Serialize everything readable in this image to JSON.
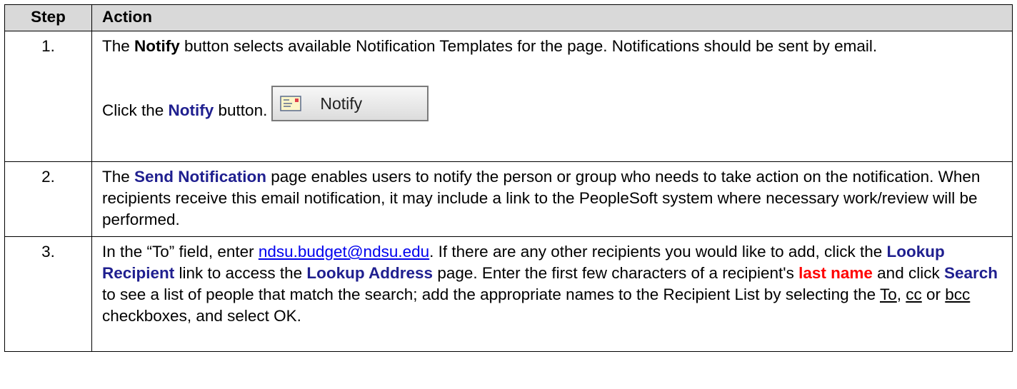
{
  "header": {
    "step": "Step",
    "action": "Action"
  },
  "rows": [
    {
      "num": "1.",
      "p1_a": "The ",
      "p1_b": "Notify",
      "p1_c": " button selects available Notification Templates for the page. Notifications should be sent by email.",
      "p2_a": "Click the ",
      "p2_b": "Notify",
      "p2_c": " button.",
      "button_label": "Notify",
      "button_icon": "envelope-icon"
    },
    {
      "num": "2.",
      "p1_a": "The ",
      "p1_b": "Send Notification",
      "p1_c": " page enables users to notify the person or group who needs to take action on the notification. When recipients receive this email notification, it may include a link to the PeopleSoft system where necessary work/review will be performed."
    },
    {
      "num": "3.",
      "t1": "In the “To” field, enter ",
      "email": "ndsu.budget@ndsu.edu",
      "t2": ".  If there are any other recipients you would like to add, click the ",
      "b1": "Lookup Recipient",
      "t3": " link to access the ",
      "b2": "Lookup Address",
      "t4": " page. Enter the first few characters of a recipient's ",
      "b3": "last name",
      "t5": " and click ",
      "b4": "Search",
      "t6": " to see a list of people that match the search; add the appropriate names to the Recipient List by selecting the ",
      "u1": "To",
      "t7": ", ",
      "u2": "cc",
      "t8": " or ",
      "u3": "bcc",
      "t9": " checkboxes, and select OK."
    }
  ],
  "colors": {
    "header_bg": "#d9d9d9",
    "highlight": "#1f1f8f",
    "emphasis_red": "#ff0000",
    "link": "#0000ee"
  }
}
